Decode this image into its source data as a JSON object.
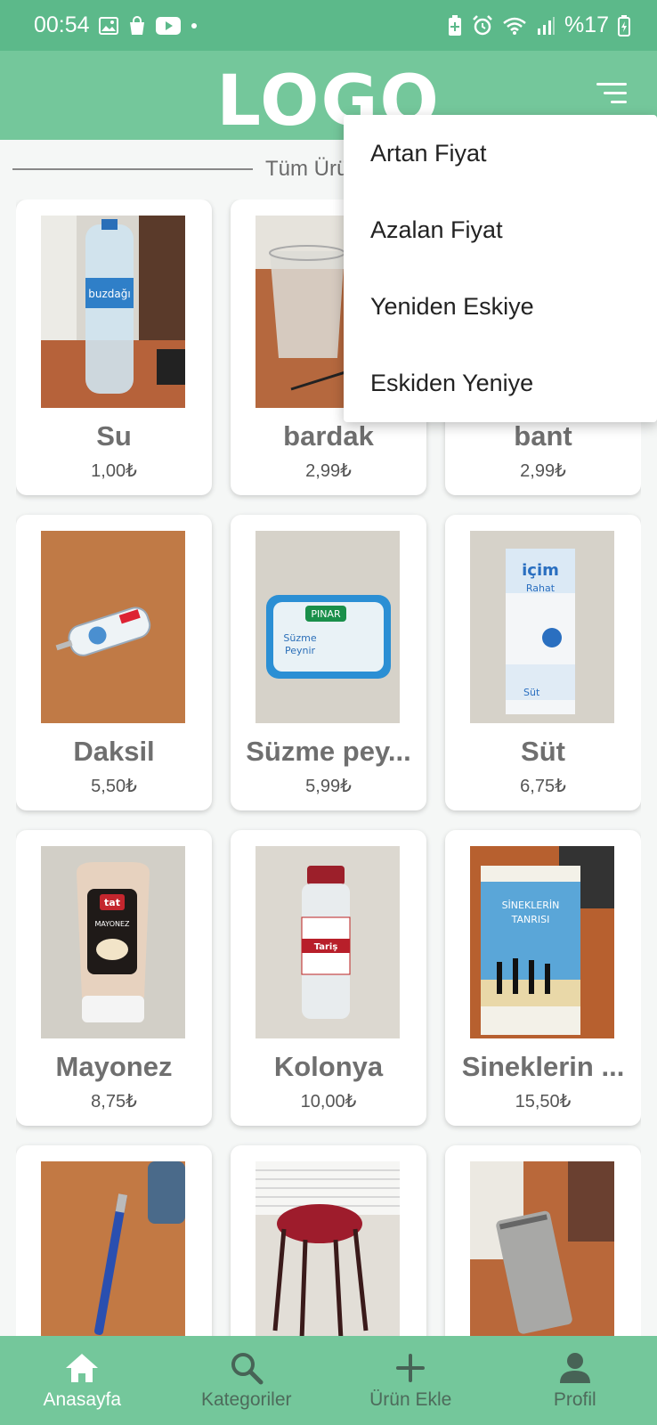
{
  "status_bar": {
    "time": "00:54",
    "battery": "%17",
    "icons": [
      "image-icon",
      "shopping-bag-icon",
      "youtube-icon",
      "dot-icon",
      "battery-saver-icon",
      "alarm-icon",
      "wifi-icon",
      "signal-icon",
      "battery-charging-icon"
    ]
  },
  "app_bar": {
    "logo": "LOGO",
    "menu_icon": "sort-icon"
  },
  "section": {
    "title": "Tüm Ürü"
  },
  "products": [
    {
      "name": "Su",
      "price": "1,00₺"
    },
    {
      "name": "bardak",
      "price": "2,99₺"
    },
    {
      "name": "bant",
      "price": "2,99₺"
    },
    {
      "name": "Daksil",
      "price": "5,50₺"
    },
    {
      "name": "Süzme pey...",
      "price": "5,99₺"
    },
    {
      "name": "Süt",
      "price": "6,75₺"
    },
    {
      "name": "Mayonez",
      "price": "8,75₺"
    },
    {
      "name": "Kolonya",
      "price": "10,00₺"
    },
    {
      "name": "Sineklerin ...",
      "price": "15,50₺"
    },
    {
      "name": "",
      "price": ""
    },
    {
      "name": "",
      "price": ""
    },
    {
      "name": "",
      "price": ""
    }
  ],
  "sort_menu": {
    "items": [
      "Artan Fiyat",
      "Azalan Fiyat",
      "Yeniden Eskiye",
      "Eskiden Yeniye"
    ]
  },
  "bottom_nav": {
    "items": [
      {
        "label": "Anasayfa",
        "icon": "home-icon"
      },
      {
        "label": "Kategoriler",
        "icon": "search-icon"
      },
      {
        "label": "Ürün Ekle",
        "icon": "plus-icon"
      },
      {
        "label": "Profil",
        "icon": "person-icon"
      }
    ]
  },
  "colors": {
    "primary": "#74c79b",
    "status_bar": "#5cb98a"
  }
}
